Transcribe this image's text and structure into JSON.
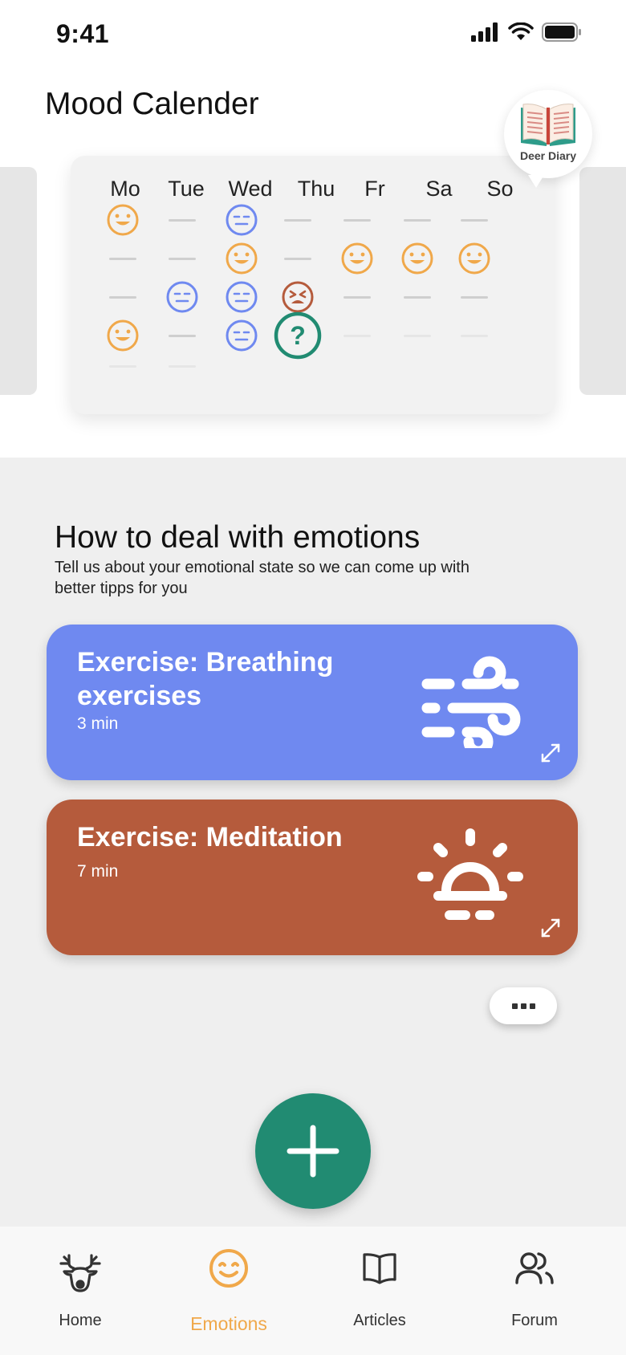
{
  "status_bar": {
    "time": "9:41"
  },
  "header": {
    "title": "Mood Calender"
  },
  "diary_badge": {
    "label": "Deer Diary",
    "icon": "open-book-icon"
  },
  "calendar": {
    "days": [
      "Mo",
      "Tue",
      "Wed",
      "Thu",
      "Fr",
      "Sa",
      "So"
    ],
    "mood_grid": [
      [
        "happy",
        "none",
        "neutral",
        "none",
        "none",
        "none",
        "none"
      ],
      [
        "none",
        "none",
        "happy",
        "none",
        "happy",
        "happy",
        "happy"
      ],
      [
        "none",
        "neutral",
        "neutral",
        "angry",
        "none",
        "none",
        "none"
      ],
      [
        "happy",
        "none",
        "neutral",
        "unknown",
        "empty",
        "empty",
        "empty"
      ],
      [
        "empty",
        "empty",
        "",
        "",
        "",
        "",
        ""
      ]
    ],
    "today_marker": "?"
  },
  "section": {
    "title": "How to deal with emotions",
    "subtitle": "Tell us about your emotional state so we can come up with better tipps for you"
  },
  "exercises": [
    {
      "title": "Exercise: Breathing exercises",
      "duration": "3 min",
      "color": "#6f89f0",
      "icon": "wind-icon"
    },
    {
      "title": "Exercise: Meditation",
      "duration": "7 min",
      "color": "#b55b3c",
      "icon": "sunrise-icon"
    }
  ],
  "more_button": {
    "icon": "more-dots-icon"
  },
  "fab": {
    "icon": "plus-icon",
    "color": "#218b72"
  },
  "bottom_nav": {
    "items": [
      {
        "label": "Home",
        "icon": "deer-icon",
        "active": false
      },
      {
        "label": "Emotions",
        "icon": "smile-icon",
        "active": true
      },
      {
        "label": "Articles",
        "icon": "book-icon",
        "active": false
      },
      {
        "label": "Forum",
        "icon": "users-icon",
        "active": false
      }
    ]
  },
  "colors": {
    "happy": "#f0a84a",
    "neutral": "#6f89f0",
    "angry": "#b55b3c",
    "accent": "#218b72"
  }
}
